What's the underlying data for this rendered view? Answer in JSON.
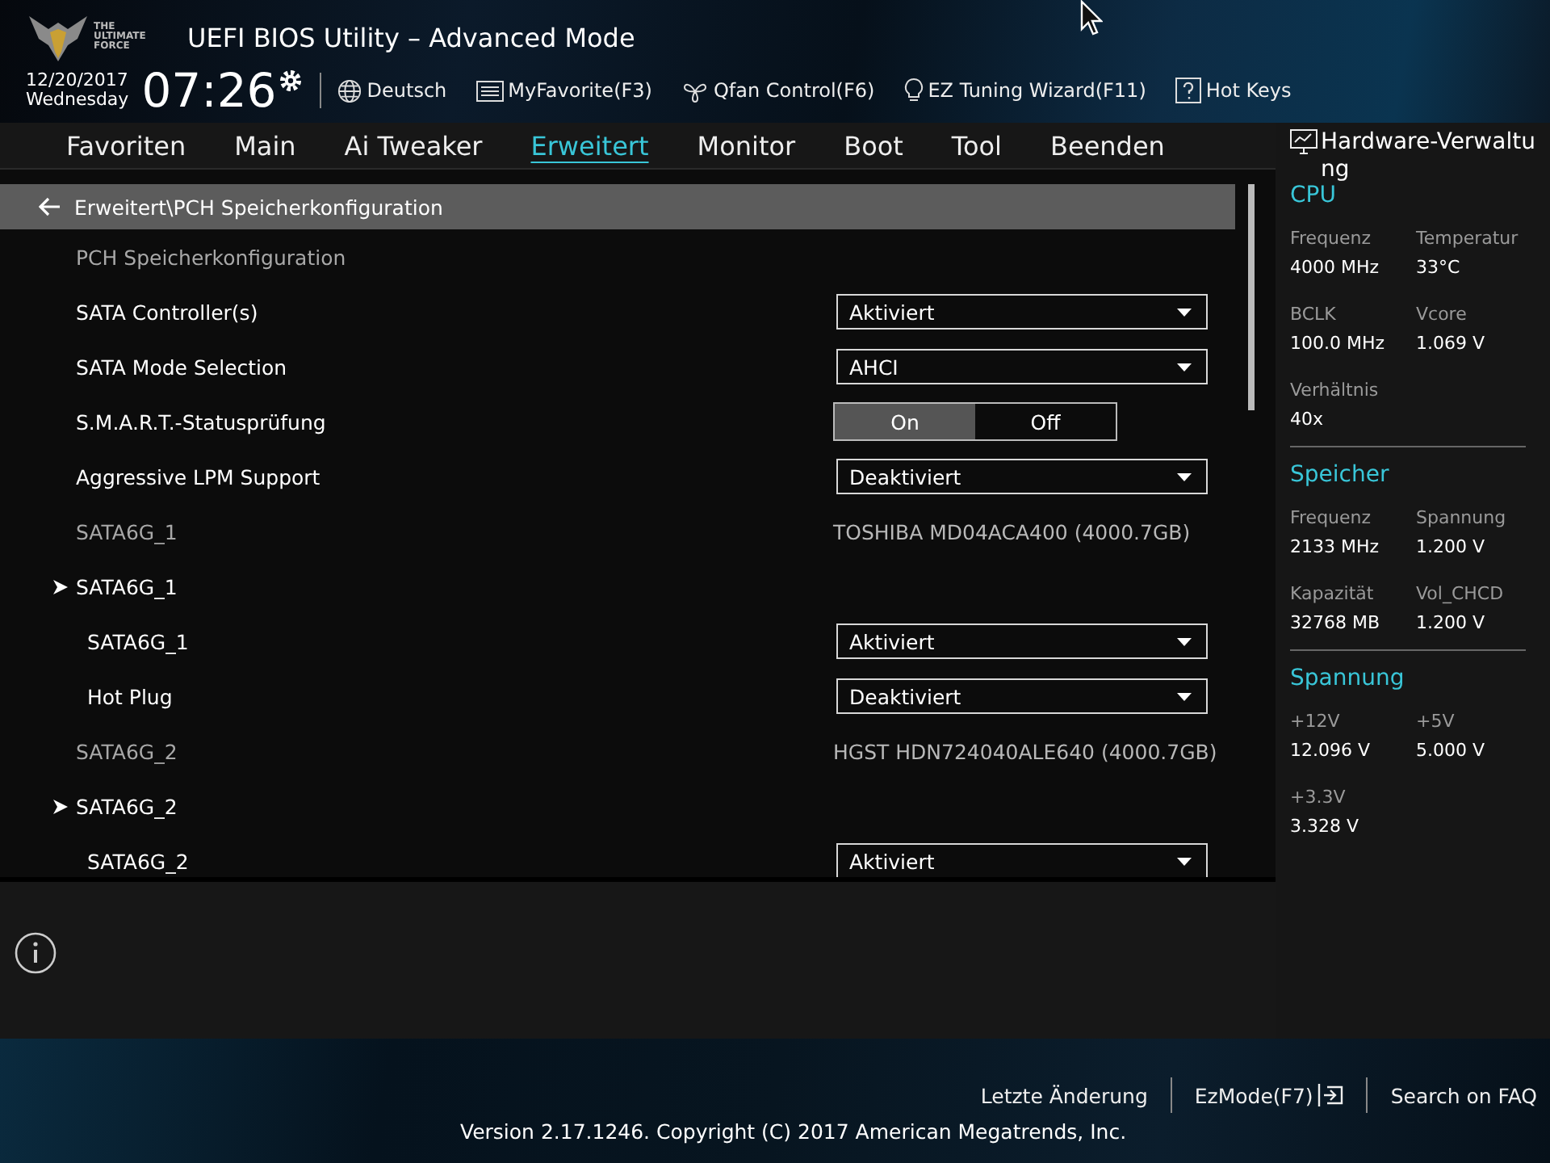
{
  "header": {
    "logo_text": "THE ULTIMATE FORCE",
    "title": "UEFI BIOS Utility – Advanced Mode",
    "date": "12/20/2017",
    "weekday": "Wednesday",
    "time": "07:26",
    "toolbar": [
      {
        "kind": "language",
        "label": "Deutsch"
      },
      {
        "kind": "favorites",
        "label": "MyFavorite(F3)"
      },
      {
        "kind": "fan",
        "label": "Qfan Control(F6)"
      },
      {
        "kind": "wizard",
        "label": "EZ Tuning Wizard(F11)"
      },
      {
        "kind": "help",
        "label": "Hot Keys"
      }
    ]
  },
  "tabs": [
    {
      "label": "Favoriten",
      "selected": false
    },
    {
      "label": "Main",
      "selected": false
    },
    {
      "label": "Ai Tweaker",
      "selected": false
    },
    {
      "label": "Erweitert",
      "selected": true
    },
    {
      "label": "Monitor",
      "selected": false
    },
    {
      "label": "Boot",
      "selected": false
    },
    {
      "label": "Tool",
      "selected": false
    },
    {
      "label": "Beenden",
      "selected": false
    }
  ],
  "breadcrumb": "Erweitert\\PCH Speicherkonfiguration",
  "settings": [
    {
      "kind": "heading",
      "label": "PCH Speicherkonfiguration"
    },
    {
      "kind": "dropdown",
      "label": "SATA Controller(s)",
      "value": "Aktiviert"
    },
    {
      "kind": "dropdown",
      "label": "SATA Mode Selection",
      "value": "AHCI"
    },
    {
      "kind": "toggle",
      "label": "S.M.A.R.T.-Statusprüfung",
      "options": [
        {
          "label": "On",
          "selected": true
        },
        {
          "label": "Off",
          "selected": false
        }
      ]
    },
    {
      "kind": "dropdown",
      "label": "Aggressive LPM Support",
      "value": "Deaktiviert"
    },
    {
      "kind": "info",
      "label": "SATA6G_1",
      "value": "TOSHIBA MD04ACA400 (4000.7GB)"
    },
    {
      "kind": "submenu",
      "label": "SATA6G_1",
      "children": [
        {
          "kind": "dropdown",
          "label": "SATA6G_1",
          "value": "Aktiviert"
        },
        {
          "kind": "dropdown",
          "label": "Hot Plug",
          "value": "Deaktiviert"
        }
      ]
    },
    {
      "kind": "info",
      "label": "SATA6G_2",
      "value": "HGST HDN724040ALE640 (4000.7GB)"
    },
    {
      "kind": "submenu",
      "label": "SATA6G_2",
      "children": [
        {
          "kind": "dropdown",
          "label": "SATA6G_2",
          "value": "Aktiviert"
        }
      ]
    }
  ],
  "hardware": {
    "title": "Hardware-Verwaltung",
    "sections": [
      {
        "title": "CPU",
        "items": [
          {
            "label": "Frequenz",
            "value": "4000 MHz"
          },
          {
            "label": "Temperatur",
            "value": "33°C"
          },
          {
            "label": "BCLK",
            "value": "100.0 MHz"
          },
          {
            "label": "Vcore",
            "value": "1.069 V"
          },
          {
            "label": "Verhältnis",
            "value": "40x"
          }
        ]
      },
      {
        "title": "Speicher",
        "items": [
          {
            "label": "Frequenz",
            "value": "2133 MHz"
          },
          {
            "label": "Spannung",
            "value": "1.200 V"
          },
          {
            "label": "Kapazität",
            "value": "32768 MB"
          },
          {
            "label": "Vol_CHCD",
            "value": "1.200 V"
          }
        ]
      },
      {
        "title": "Spannung",
        "items": [
          {
            "label": "+12V",
            "value": "12.096 V"
          },
          {
            "label": "+5V",
            "value": "5.000 V"
          },
          {
            "label": "+3.3V",
            "value": "3.328 V"
          }
        ]
      }
    ]
  },
  "footer": {
    "links": [
      {
        "label": "Letzte Änderung",
        "kind": "plain"
      },
      {
        "label": "EzMode(F7)",
        "kind": "exit"
      },
      {
        "label": "Search on FAQ",
        "kind": "plain"
      }
    ],
    "version": "Version 2.17.1246. Copyright (C) 2017 American Megatrends, Inc."
  }
}
